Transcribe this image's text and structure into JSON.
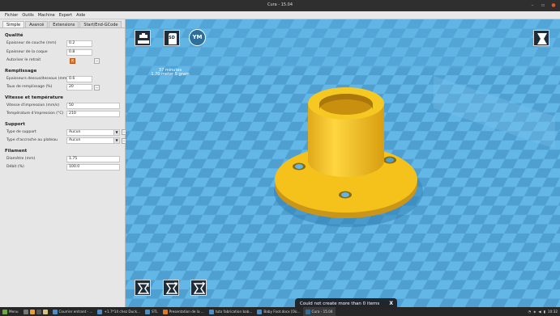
{
  "window": {
    "title": "Cura - 15.04"
  },
  "menu": [
    "Fichier",
    "Outils",
    "Machine",
    "Expert",
    "Aide"
  ],
  "tabs": [
    "Simple",
    "Avancé",
    "Extensions",
    "Start/End-GCode"
  ],
  "sections": {
    "qualite": "Qualité",
    "remplissage": "Remplissage",
    "vitesse": "Vitesse et température",
    "support": "Support",
    "filament": "Filament"
  },
  "fields": {
    "layer_height": {
      "label": "Epaisseur de couche (mm)",
      "value": "0.2"
    },
    "shell_thickness": {
      "label": "Epaisseur de la coque",
      "value": "0.8"
    },
    "retraction": {
      "label": "Autoriser le retrait",
      "checked": "x"
    },
    "top_bottom": {
      "label": "Epaisseurs dessus/dessous (mm)",
      "value": "0.6"
    },
    "fill_density": {
      "label": "Taux de remplissage (%)",
      "value": "20"
    },
    "print_speed": {
      "label": "Vitesse d'impression (mm/s)",
      "value": "50"
    },
    "print_temp": {
      "label": "Température d'impression (°C)",
      "value": "210"
    },
    "support_type": {
      "label": "Type de support",
      "value": "Aucun"
    },
    "platform_adhesion": {
      "label": "Type d'accroche au plateau",
      "value": "Aucun"
    },
    "diameter": {
      "label": "Diamètre (mm)",
      "value": "1.75"
    },
    "flow": {
      "label": "Débit (%)",
      "value": "100.0"
    }
  },
  "viewport": {
    "print_time": "37 minutes",
    "print_material": "1.70 meter 5 gram"
  },
  "toolbar": {
    "sd_label": "SD",
    "ym_label": "YM"
  },
  "toast": {
    "message": "Could not create more than 0 items",
    "close": "X"
  },
  "taskbar": {
    "menu": "Menu",
    "items": [
      "Courrier entrant - ...",
      "+1.7*14 chez Duck...",
      "STL",
      "Presentation de la ...",
      "tuto fabrication bab...",
      "Baby Foot.docx [Où...",
      "Cura - 15.04"
    ],
    "clock": "10:32"
  },
  "colors": {
    "viewport_bg": "#5fb3e3",
    "checker_dark": "#4f9fd1",
    "model": "#f5c21b",
    "model_shadow": "#c9961a",
    "toast_bg": "#20262d"
  }
}
